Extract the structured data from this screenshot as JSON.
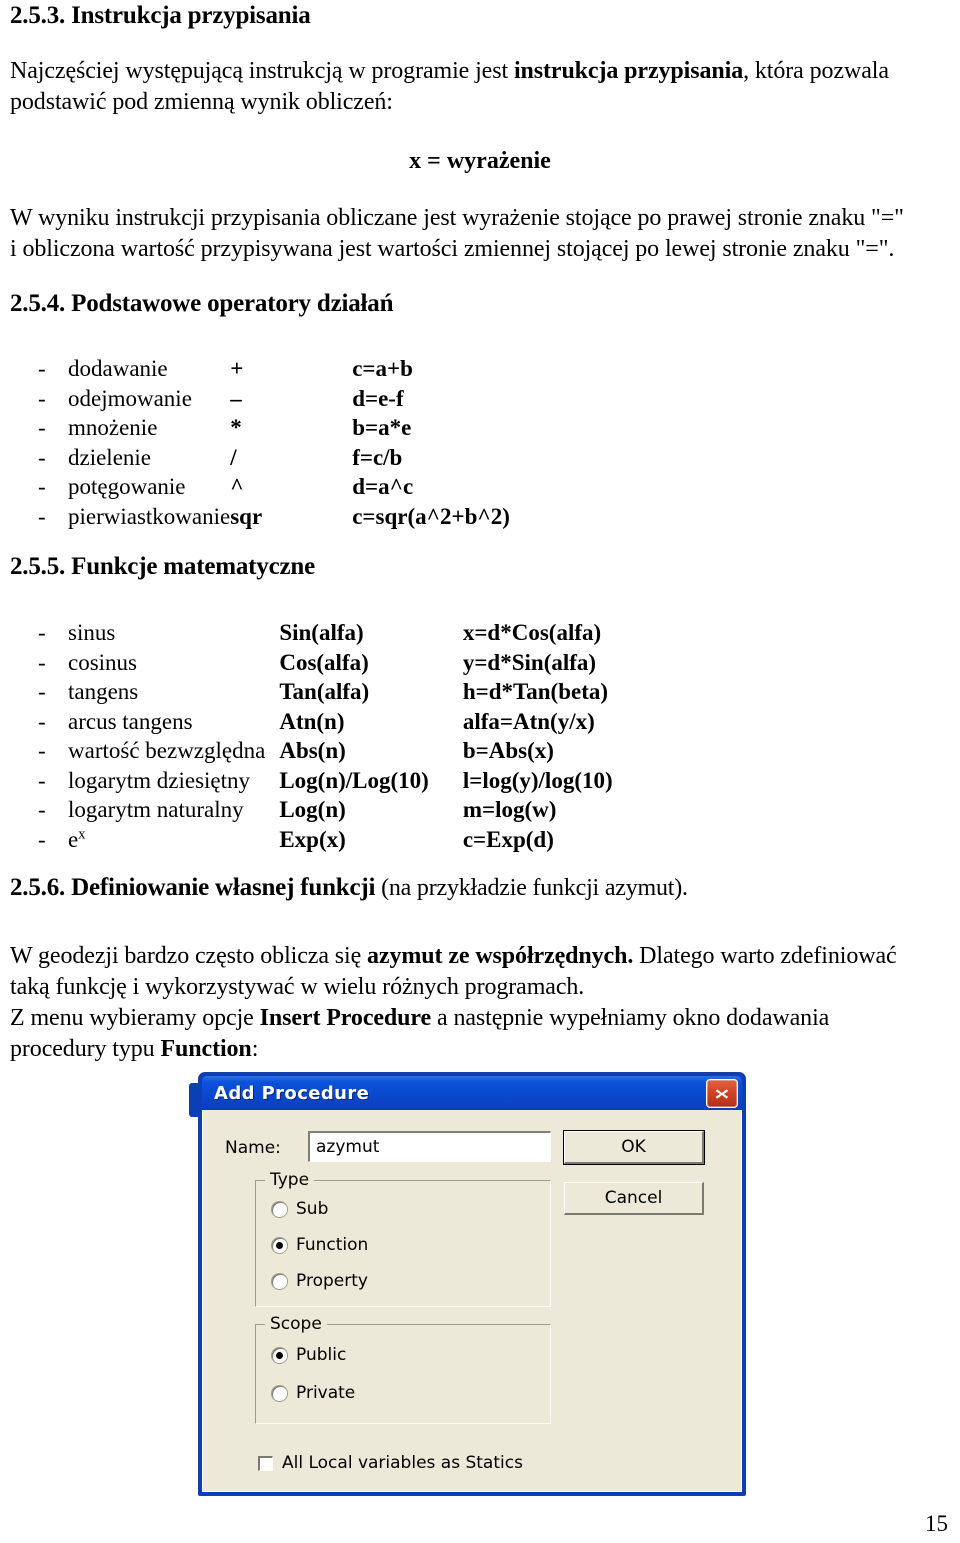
{
  "document": {
    "page_number": "15"
  },
  "sections": {
    "s253": {
      "number": "2.5.3.",
      "title": "Instrukcja przypisania",
      "para1_before": "Najczęściej występującą instrukcją  w programie jest ",
      "para1_bold": "instrukcja przypisania",
      "para1_after": ", która pozwala podstawić pod zmienną wynik obliczeń:",
      "formula": "x = wyrażenie",
      "para2_line1": "W wyniku instrukcji przypisania obliczane jest wyrażenie stojące po prawej stronie znaku \"=\"",
      "para2_line2": "i obliczona wartość przypisywana jest wartości zmiennej stojącej po lewej stronie znaku \"=\"."
    },
    "s254": {
      "number": "2.5.4.",
      "title": "Podstawowe operatory działań",
      "bullet": "-",
      "rows": [
        {
          "name": "dodawanie",
          "symbol": "+",
          "example": "c=a+b"
        },
        {
          "name": "odejmowanie",
          "symbol": "–",
          "example": "d=e-f"
        },
        {
          "name": "mnożenie",
          "symbol": "*",
          "example": "b=a*e"
        },
        {
          "name": "dzielenie",
          "symbol": "/",
          "example": "f=c/b"
        },
        {
          "name": "potęgowanie",
          "symbol": "^",
          "example": "d=a^c"
        },
        {
          "name": "pierwiastkowanie",
          "symbol": "sqr",
          "example": "c=sqr(a^2+b^2)"
        }
      ]
    },
    "s255": {
      "number": "2.5.5.",
      "title": "Funkcje matematyczne",
      "bullet": "-",
      "rows": [
        {
          "name": "sinus",
          "func": "Sin(alfa)",
          "example": "x=d*Cos(alfa)"
        },
        {
          "name": "cosinus",
          "func": "Cos(alfa)",
          "example": "y=d*Sin(alfa)"
        },
        {
          "name": "tangens",
          "func": "Tan(alfa)",
          "example": "h=d*Tan(beta)"
        },
        {
          "name": "arcus tangens",
          "func": "Atn(n)",
          "example": "alfa=Atn(y/x)"
        },
        {
          "name": "wartość bezwzględna",
          "func": "Abs(n)",
          "example": "b=Abs(x)"
        },
        {
          "name": "logarytm dziesiętny",
          "func": "Log(n)/Log(10)",
          "example": "l=log(y)/log(10)"
        },
        {
          "name": "logarytm naturalny",
          "func": "Log(n)",
          "example": "m=log(w)"
        },
        {
          "name": "e",
          "name_sup": "x",
          "func": "Exp(x)",
          "example": "c=Exp(d)"
        }
      ]
    },
    "s256": {
      "number": "2.5.6.",
      "title": "Definiowanie własnej funkcji",
      "title_tail": " (na przykładzie funkcji azymut).",
      "p_line1_a": "W geodezji bardzo często oblicza się ",
      "p_line1_b": "azymut ze współrzędnych.",
      "p_line1_c": " Dlatego warto zdefiniować",
      "p_line2": "taką funkcję i wykorzystywać w wielu różnych programach.",
      "p_line3_a": "Z menu wybieramy opcje ",
      "p_line3_b": "Insert   Procedure",
      "p_line3_c": " a następnie wypełniamy okno dodawania",
      "p_line4_a": "procedury typu ",
      "p_line4_b": "Function",
      "p_line4_c": ":"
    }
  },
  "dialog": {
    "title": "Add Procedure",
    "close_icon": "close-icon",
    "name_label": "Name:",
    "name_value": "azymut",
    "name_placeholder": "",
    "ok_label": "OK",
    "cancel_label": "Cancel",
    "type_group_label": "Type",
    "type_options": [
      {
        "label": "Sub",
        "checked": false
      },
      {
        "label": "Function",
        "checked": true
      },
      {
        "label": "Property",
        "checked": false
      }
    ],
    "scope_group_label": "Scope",
    "scope_options": [
      {
        "label": "Public",
        "checked": true
      },
      {
        "label": "Private",
        "checked": false
      }
    ],
    "statics_label": "All Local variables as Statics",
    "statics_checked": false,
    "colors": {
      "titlebar": "#0a49cf",
      "face": "#ece9d8",
      "close": "#c2361c"
    }
  }
}
